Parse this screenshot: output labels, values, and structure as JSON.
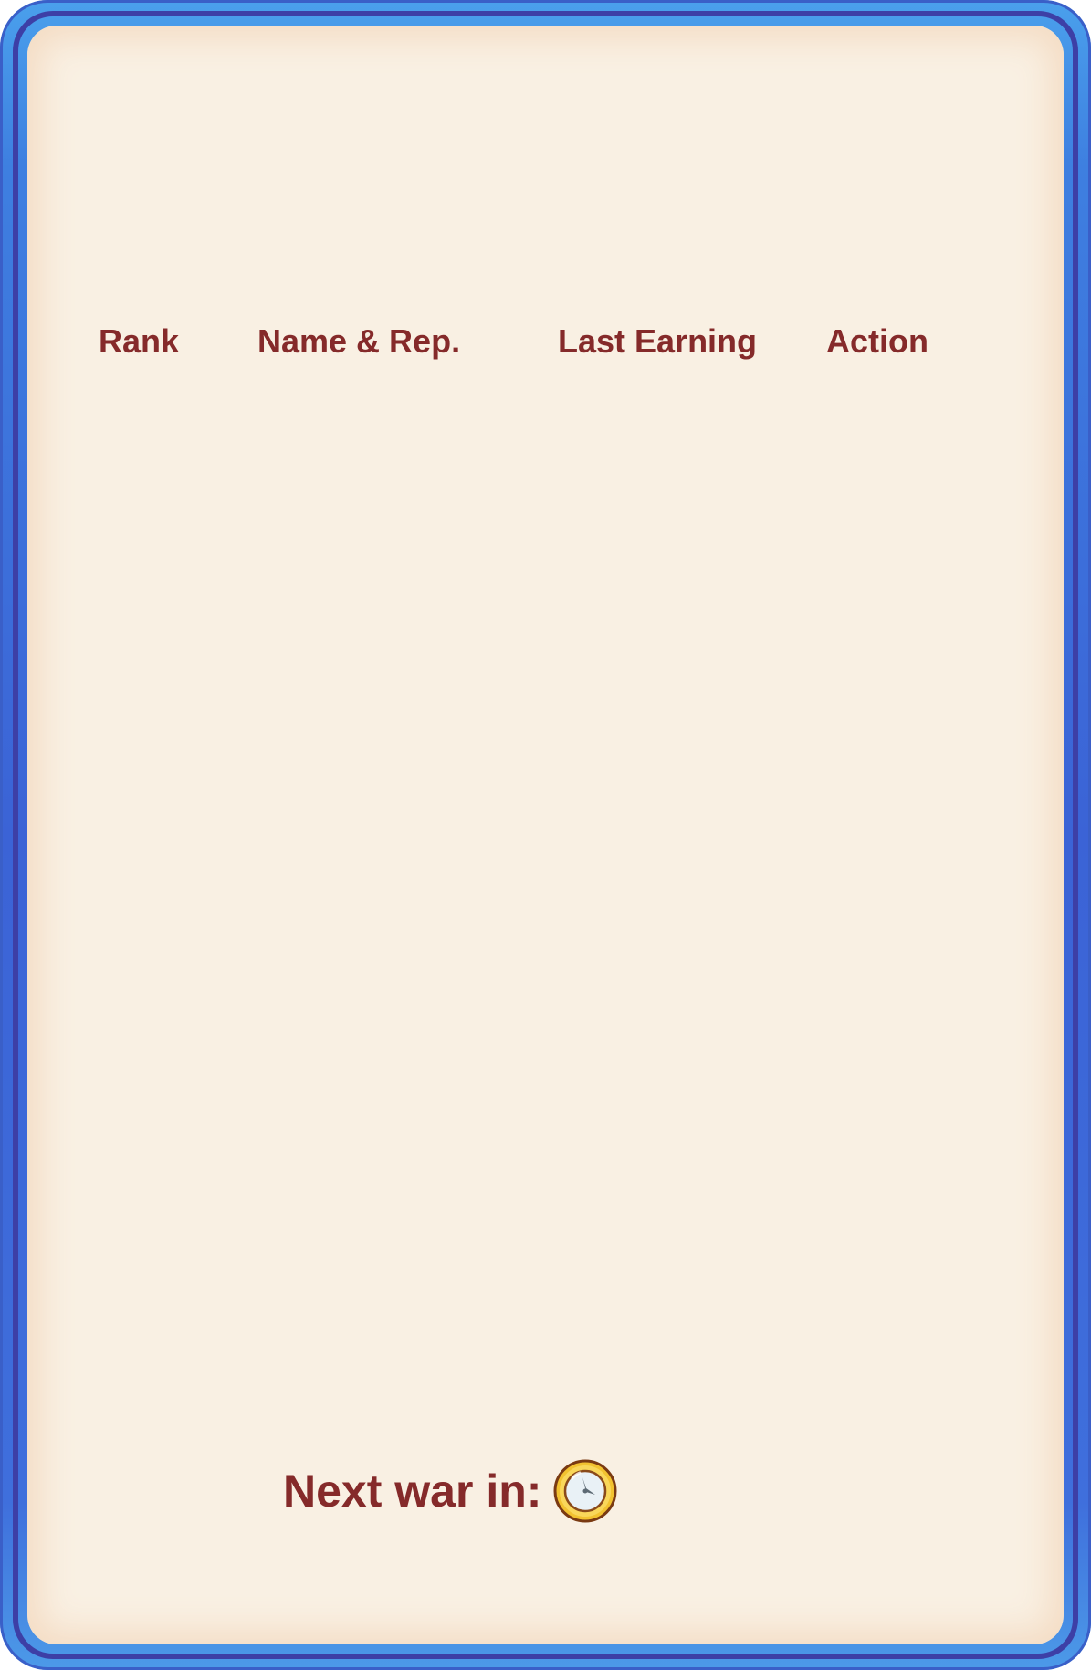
{
  "table": {
    "headers": {
      "rank": "Rank",
      "name": "Name & Rep.",
      "last_earning": "Last Earning",
      "action": "Action"
    }
  },
  "footer": {
    "next_war_label": "Next war in:",
    "timer_icon": "clock-icon"
  },
  "colors": {
    "frame_blue": "#3b63d6",
    "panel_cream": "#f9f0e3",
    "text_maroon": "#852a2a",
    "clock_gold": "#f2c230"
  }
}
